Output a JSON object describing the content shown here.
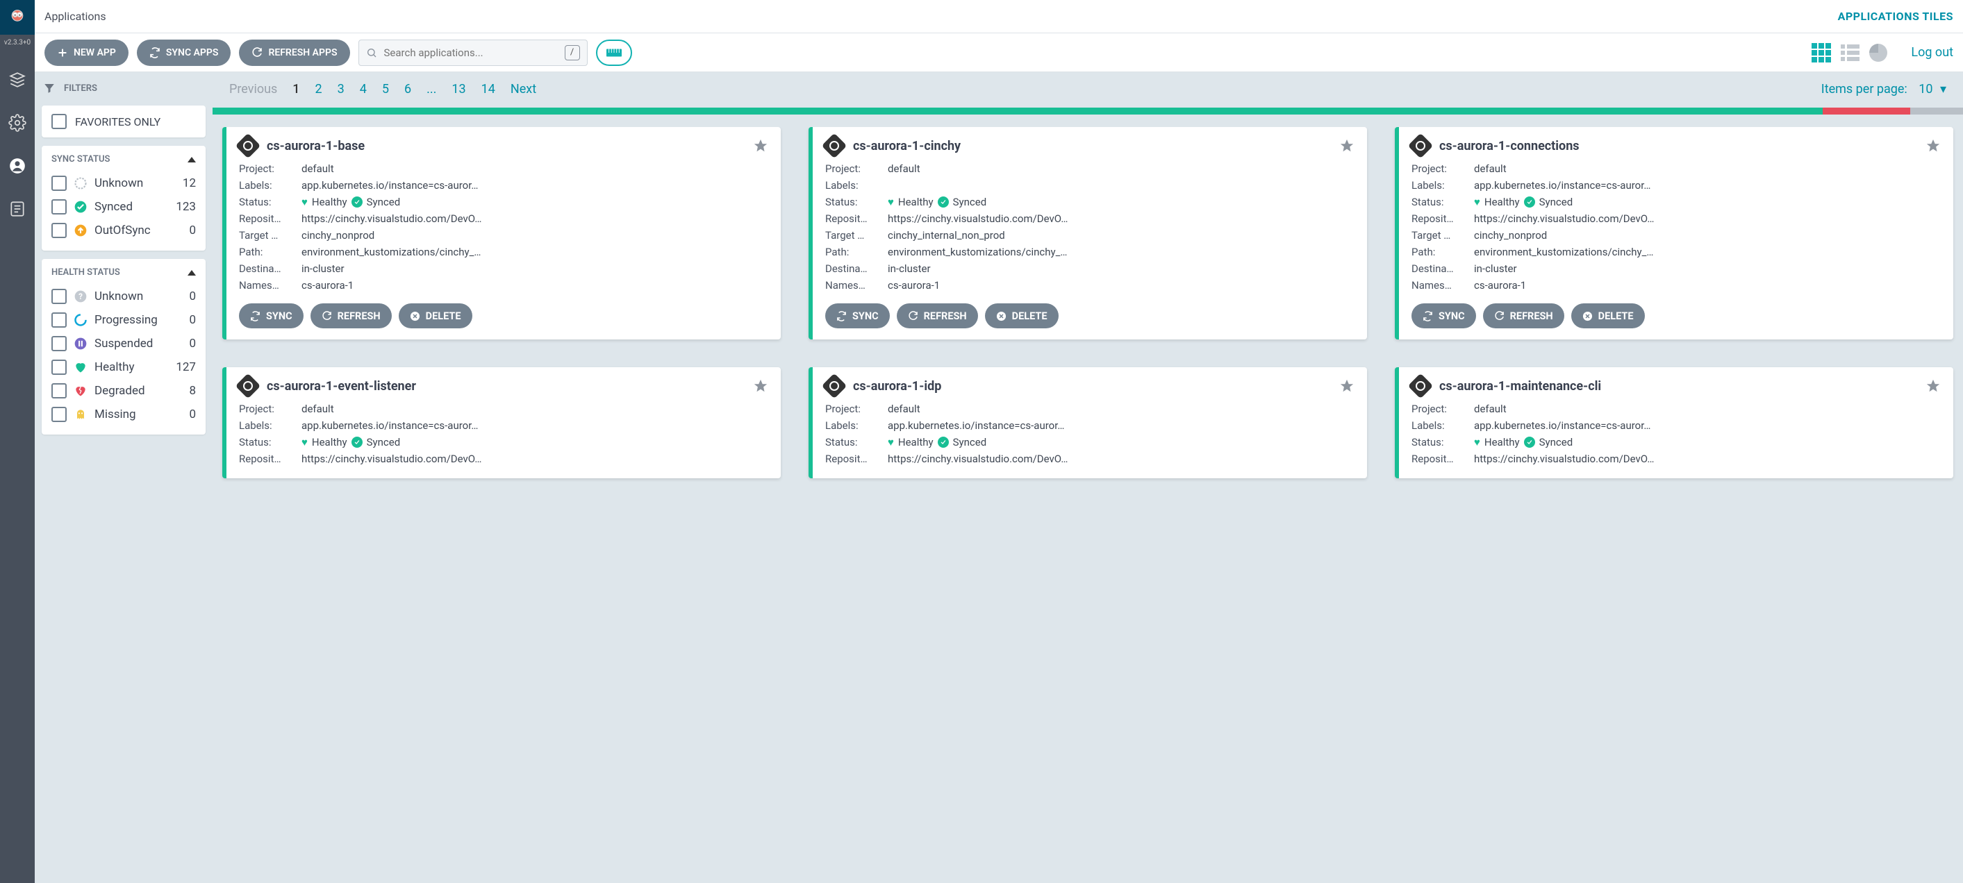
{
  "header": {
    "title": "Applications",
    "tiles_link": "APPLICATIONS TILES"
  },
  "version": "v2.3.3+0",
  "toolbar": {
    "new_app": "NEW APP",
    "sync_apps": "SYNC APPS",
    "refresh_apps": "REFRESH APPS",
    "search_placeholder": "Search applications...",
    "slash": "/",
    "logout": "Log out"
  },
  "pager": {
    "previous": "Previous",
    "pages": [
      "1",
      "2",
      "3",
      "4",
      "5",
      "6",
      "...",
      "13",
      "14"
    ],
    "current": "1",
    "next": "Next",
    "per_page_label": "Items per page:",
    "per_page_value": "10"
  },
  "progress": [
    {
      "color": "#18be94",
      "pct": 92
    },
    {
      "color": "#e74c5b",
      "pct": 5
    },
    {
      "color": "#b9c0c7",
      "pct": 3
    }
  ],
  "filters": {
    "label": "FILTERS",
    "favorites": "FAVORITES ONLY",
    "sync_status": {
      "title": "SYNC STATUS",
      "items": [
        {
          "label": "Unknown",
          "count": "12",
          "icon": "circle-outline",
          "color": "#b9c0c7"
        },
        {
          "label": "Synced",
          "count": "123",
          "icon": "check-circle",
          "color": "#18be94"
        },
        {
          "label": "OutOfSync",
          "count": "0",
          "icon": "arrow-up-circle",
          "color": "#f5a623"
        }
      ]
    },
    "health_status": {
      "title": "HEALTH STATUS",
      "items": [
        {
          "label": "Unknown",
          "count": "0",
          "icon": "question-circle",
          "color": "#c4cad1"
        },
        {
          "label": "Progressing",
          "count": "0",
          "icon": "spinner",
          "color": "#0da6d8"
        },
        {
          "label": "Suspended",
          "count": "0",
          "icon": "pause-circle",
          "color": "#7668c6"
        },
        {
          "label": "Healthy",
          "count": "127",
          "icon": "heart",
          "color": "#18be94"
        },
        {
          "label": "Degraded",
          "count": "8",
          "icon": "heart-broken",
          "color": "#e74c5b"
        },
        {
          "label": "Missing",
          "count": "0",
          "icon": "ghost",
          "color": "#f2c94c"
        }
      ]
    }
  },
  "status_labels": {
    "healthy": "Healthy",
    "synced": "Synced"
  },
  "detail_labels": {
    "project": "Project:",
    "labels": "Labels:",
    "status": "Status:",
    "repo": "Reposit…",
    "target": "Target …",
    "path": "Path:",
    "dest": "Destina…",
    "ns": "Names…"
  },
  "tile_actions": {
    "sync": "SYNC",
    "refresh": "REFRESH",
    "delete": "DELETE"
  },
  "apps": [
    {
      "name": "cs-aurora-1-base",
      "project": "default",
      "labels": "app.kubernetes.io/instance=cs-auror…",
      "repo": "https://cinchy.visualstudio.com/DevO…",
      "target": "cinchy_nonprod",
      "path": "environment_kustomizations/cinchy_…",
      "dest": "in-cluster",
      "ns": "cs-aurora-1"
    },
    {
      "name": "cs-aurora-1-cinchy",
      "project": "default",
      "labels": "",
      "repo": "https://cinchy.visualstudio.com/DevO…",
      "target": "cinchy_internal_non_prod",
      "path": "environment_kustomizations/cinchy_…",
      "dest": "in-cluster",
      "ns": "cs-aurora-1"
    },
    {
      "name": "cs-aurora-1-connections",
      "project": "default",
      "labels": "app.kubernetes.io/instance=cs-auror…",
      "repo": "https://cinchy.visualstudio.com/DevO…",
      "target": "cinchy_nonprod",
      "path": "environment_kustomizations/cinchy_…",
      "dest": "in-cluster",
      "ns": "cs-aurora-1"
    },
    {
      "name": "cs-aurora-1-event-listener",
      "project": "default",
      "labels": "app.kubernetes.io/instance=cs-auror…",
      "repo": "https://cinchy.visualstudio.com/DevO…",
      "target": "",
      "path": "",
      "dest": "",
      "ns": ""
    },
    {
      "name": "cs-aurora-1-idp",
      "project": "default",
      "labels": "app.kubernetes.io/instance=cs-auror…",
      "repo": "https://cinchy.visualstudio.com/DevO…",
      "target": "",
      "path": "",
      "dest": "",
      "ns": ""
    },
    {
      "name": "cs-aurora-1-maintenance-cli",
      "project": "default",
      "labels": "app.kubernetes.io/instance=cs-auror…",
      "repo": "https://cinchy.visualstudio.com/DevO…",
      "target": "",
      "path": "",
      "dest": "",
      "ns": ""
    }
  ]
}
